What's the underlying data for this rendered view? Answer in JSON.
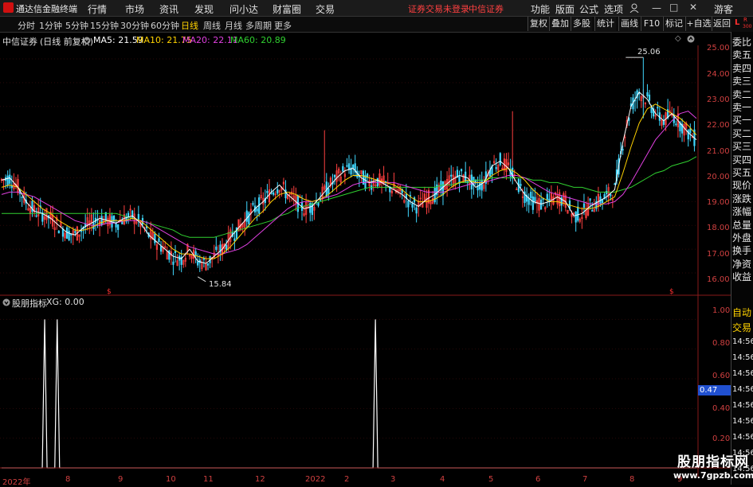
{
  "app": {
    "title": "通达信金融终端",
    "menu": [
      "行情",
      "市场",
      "资讯",
      "发现",
      "问小达",
      "财富圈",
      "交易"
    ],
    "notice": "证券交易未登录",
    "broker": "中信证券",
    "right_menu": [
      "功能",
      "版面",
      "公式",
      "选项"
    ],
    "guest": "游客"
  },
  "periods": {
    "items": [
      "分时",
      "1分钟",
      "5分钟",
      "15分钟",
      "30分钟",
      "60分钟",
      "日线",
      "周线",
      "月线",
      "多周期",
      "更多"
    ],
    "selected": "日线"
  },
  "toolbar": [
    "复权",
    "叠加",
    "多股",
    "统计",
    "画线",
    "F10",
    "标记",
    "+自选",
    "返回"
  ],
  "stock": {
    "name": "中信证券",
    "mode": "(日线 前复权)",
    "ma": [
      {
        "label": "MA5: 21.59",
        "color": "#ffffff"
      },
      {
        "label": "MA10: 21.75",
        "color": "#ffd200"
      },
      {
        "label": "MA20: 22.11",
        "color": "#e040e0"
      },
      {
        "label": "MA60: 20.89",
        "color": "#30d030"
      }
    ],
    "high_label": "25.06",
    "low_label": "15.84"
  },
  "indicator": {
    "name": "股朋指标",
    "label": "XG: 0.00",
    "value_box": "0.47"
  },
  "right_panel": {
    "corner": "L",
    "corner2": "R",
    "corner3": "300",
    "labels": [
      "委比",
      "卖五",
      "卖四",
      "卖三",
      "卖二",
      "卖一",
      "买一",
      "买二",
      "买三",
      "买四",
      "买五",
      "现价",
      "涨跌",
      "涨幅",
      "总量",
      "外盘",
      "换手",
      "净资",
      "收益"
    ],
    "bottom": [
      "自动",
      "交易"
    ],
    "times": [
      "14:56",
      "14:56",
      "14:56",
      "14:56",
      "14:56",
      "14:56",
      "14:56",
      "14:56",
      "14:56"
    ]
  },
  "axis_main": [
    "25.00",
    "24.00",
    "23.00",
    "22.00",
    "21.00",
    "20.00",
    "19.00",
    "18.00",
    "17.00",
    "16.00"
  ],
  "axis_ind": [
    "1.00",
    "0.80",
    "0.60",
    "0.40",
    "0.20"
  ],
  "x_ticks": [
    "2022年",
    "8",
    "9",
    "10",
    "11",
    "12",
    "2022",
    "2",
    "3",
    "4",
    "5",
    "6",
    "7",
    "8",
    "9"
  ],
  "watermark": {
    "line1": "股朋指标网",
    "line2": "www.7gpzb.com"
  },
  "chart_data": {
    "type": "line",
    "title": "",
    "main_ylim": [
      15.5,
      25.4
    ],
    "indicator_ylim": [
      0,
      1.05
    ],
    "ma5": [
      19.9,
      20.0,
      19.6,
      19.0,
      18.6,
      18.5,
      18.3,
      18.0,
      17.7,
      17.6,
      17.9,
      18.1,
      18.3,
      18.2,
      18.1,
      18.3,
      18.4,
      18.1,
      17.6,
      17.3,
      17.0,
      16.7,
      16.6,
      17.0,
      16.5,
      16.4,
      16.7,
      17.0,
      17.5,
      17.9,
      18.3,
      18.7,
      19.0,
      19.4,
      19.7,
      19.3,
      19.0,
      18.7,
      18.8,
      19.2,
      19.6,
      20.0,
      20.3,
      20.4,
      20.0,
      19.8,
      19.9,
      19.7,
      19.5,
      19.3,
      19.0,
      18.8,
      19.1,
      19.3,
      19.6,
      19.9,
      20.1,
      20.0,
      19.6,
      19.8,
      20.5,
      20.7,
      20.4,
      19.8,
      19.3,
      19.0,
      18.9,
      19.0,
      19.2,
      19.0,
      18.4,
      18.5,
      18.8,
      19.0,
      19.2,
      19.5,
      21.5,
      23.0,
      23.6,
      23.3,
      22.7,
      22.4,
      22.7,
      22.3,
      21.9,
      21.6
    ],
    "ma10": [
      19.6,
      19.7,
      19.6,
      19.3,
      19.0,
      18.7,
      18.5,
      18.2,
      18.0,
      17.8,
      17.8,
      17.9,
      18.1,
      18.2,
      18.2,
      18.2,
      18.3,
      18.2,
      17.9,
      17.6,
      17.3,
      17.0,
      16.8,
      16.8,
      16.7,
      16.6,
      16.6,
      16.8,
      17.1,
      17.5,
      17.9,
      18.3,
      18.6,
      19.0,
      19.3,
      19.4,
      19.3,
      19.1,
      19.0,
      19.1,
      19.3,
      19.6,
      19.9,
      20.1,
      20.1,
      20.0,
      19.9,
      19.8,
      19.7,
      19.5,
      19.2,
      19.0,
      19.0,
      19.1,
      19.3,
      19.6,
      19.8,
      19.9,
      19.8,
      19.8,
      20.1,
      20.3,
      20.4,
      20.2,
      19.9,
      19.5,
      19.2,
      19.0,
      19.0,
      18.9,
      18.8,
      18.7,
      18.7,
      18.8,
      19.0,
      19.2,
      20.2,
      21.3,
      22.3,
      22.9,
      23.1,
      22.9,
      22.7,
      22.5,
      22.2,
      21.8
    ],
    "ma20": [
      19.3,
      19.4,
      19.4,
      19.3,
      19.2,
      19.0,
      18.8,
      18.6,
      18.4,
      18.2,
      18.1,
      18.0,
      18.0,
      18.1,
      18.1,
      18.2,
      18.2,
      18.2,
      18.1,
      17.9,
      17.7,
      17.5,
      17.3,
      17.1,
      17.0,
      16.9,
      16.8,
      16.8,
      16.9,
      17.0,
      17.2,
      17.5,
      17.8,
      18.1,
      18.4,
      18.7,
      18.9,
      19.0,
      19.0,
      19.1,
      19.2,
      19.3,
      19.5,
      19.7,
      19.8,
      19.8,
      19.8,
      19.8,
      19.8,
      19.7,
      19.6,
      19.5,
      19.4,
      19.4,
      19.4,
      19.5,
      19.6,
      19.7,
      19.8,
      19.8,
      19.9,
      20.0,
      20.1,
      20.1,
      20.0,
      19.8,
      19.6,
      19.4,
      19.3,
      19.2,
      19.1,
      19.0,
      18.9,
      18.9,
      18.9,
      19.0,
      19.3,
      19.8,
      20.4,
      21.0,
      21.6,
      22.0,
      22.4,
      22.7,
      22.8,
      22.5
    ],
    "ma60": [
      18.5,
      18.5,
      18.5,
      18.5,
      18.5,
      18.5,
      18.5,
      18.5,
      18.5,
      18.5,
      18.5,
      18.5,
      18.5,
      18.5,
      18.5,
      18.4,
      18.3,
      18.2,
      18.1,
      18.0,
      17.9,
      17.8,
      17.6,
      17.5,
      17.5,
      17.5,
      17.5,
      17.6,
      17.7,
      17.8,
      17.9,
      18.0,
      18.1,
      18.2,
      18.4,
      18.5,
      18.7,
      18.8,
      18.9,
      19.0,
      19.1,
      19.2,
      19.3,
      19.4,
      19.5,
      19.6,
      19.6,
      19.6,
      19.6,
      19.6,
      19.6,
      19.6,
      19.6,
      19.6,
      19.7,
      19.7,
      19.8,
      19.8,
      19.9,
      19.9,
      20.0,
      20.0,
      20.0,
      20.0,
      20.0,
      19.9,
      19.9,
      19.8,
      19.8,
      19.7,
      19.6,
      19.6,
      19.5,
      19.4,
      19.4,
      19.4,
      19.5,
      19.6,
      19.8,
      20.0,
      20.2,
      20.3,
      20.5,
      20.6,
      20.7,
      20.89
    ],
    "xg_spikes": [
      {
        "x": 0.062,
        "y": 1
      },
      {
        "x": 0.08,
        "y": 1
      },
      {
        "x": 0.538,
        "y": 1
      }
    ]
  }
}
